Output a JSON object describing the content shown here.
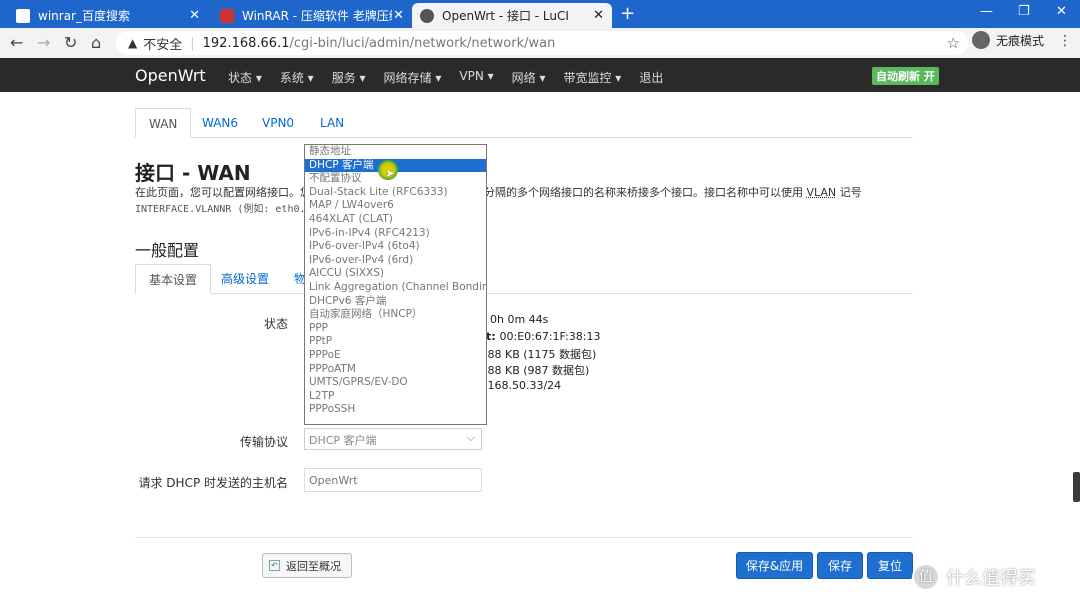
{
  "browser": {
    "tabs": [
      {
        "title": "winrar_百度搜索"
      },
      {
        "title": "WinRAR - 压缩软件 老牌压缩软"
      },
      {
        "title": "OpenWrt - 接口 - LuCI"
      }
    ],
    "new_tab": "+",
    "url_warning": "不安全",
    "url_host": "192.168.66.1",
    "url_path": "/cgi-bin/luci/admin/network/network/wan",
    "profile_label": "无痕模式"
  },
  "openwrt": {
    "brand": "OpenWrt",
    "menu": [
      "状态 ▾",
      "系统 ▾",
      "服务 ▾",
      "网络存储 ▾",
      "VPN ▾",
      "网络 ▾",
      "带宽监控 ▾",
      "退出"
    ],
    "auto_refresh": "自动刷新 开"
  },
  "interface_tabs": [
    "WAN",
    "WAN6",
    "VPN0",
    "LAN"
  ],
  "page": {
    "title": "接口 - WAN",
    "desc_left": "在此页面，您可以配置网络接口。您",
    "desc_right": "分隔的多个网络接口的名称来桥接多个接口。接口名称中可以使用",
    "desc_vlan": "VLAN",
    "desc_tail": "记号",
    "code_line": "INTERFACE.VLANNR (例如: eth0.1)",
    "section_title": "一般配置",
    "sub_tabs": [
      "基本设置",
      "高级设置",
      "物"
    ]
  },
  "form": {
    "status_label": "状态",
    "status_uptime": "0h 0m 44s",
    "status_mac_prefix": "t: ",
    "status_mac": "00:E0:67:1F:38:13",
    "status_rx": ".88 KB (1175 数据包)",
    "status_tx": ".88 KB (987 数据包)",
    "status_ip": ".168.50.33/24",
    "protocol_label": "传输协议",
    "protocol_value": "DHCP 客户端",
    "hostname_label": "请求 DHCP 时发送的主机名",
    "hostname_placeholder": "OpenWrt"
  },
  "dropdown_options": [
    "静态地址",
    "DHCP 客户端",
    "不配置协议",
    "Dual-Stack Lite (RFC6333)",
    "MAP / LW4over6",
    "464XLAT (CLAT)",
    "IPv6-in-IPv4 (RFC4213)",
    "IPv6-over-IPv4 (6to4)",
    "IPv6-over-IPv4 (6rd)",
    "AICCU (SIXXS)",
    "Link Aggregation (Channel Bonding)",
    "DHCPv6 客户端",
    "自动家庭网络（HNCP）",
    "PPP",
    "PPtP",
    "PPPoE",
    "PPPoATM",
    "UMTS/GPRS/EV-DO",
    "L2TP",
    "PPPoSSH"
  ],
  "dropdown_selected_index": 1,
  "buttons": {
    "back": "返回至概况",
    "save_apply": "保存&应用",
    "save": "保存",
    "reset": "复位"
  },
  "watermark": "什么值得买",
  "colors": {
    "tabstrip": "#1f66cc",
    "navbar": "#2a2a2a",
    "primary_button": "#1e6fd0",
    "auto_refresh": "#5cb85c"
  }
}
